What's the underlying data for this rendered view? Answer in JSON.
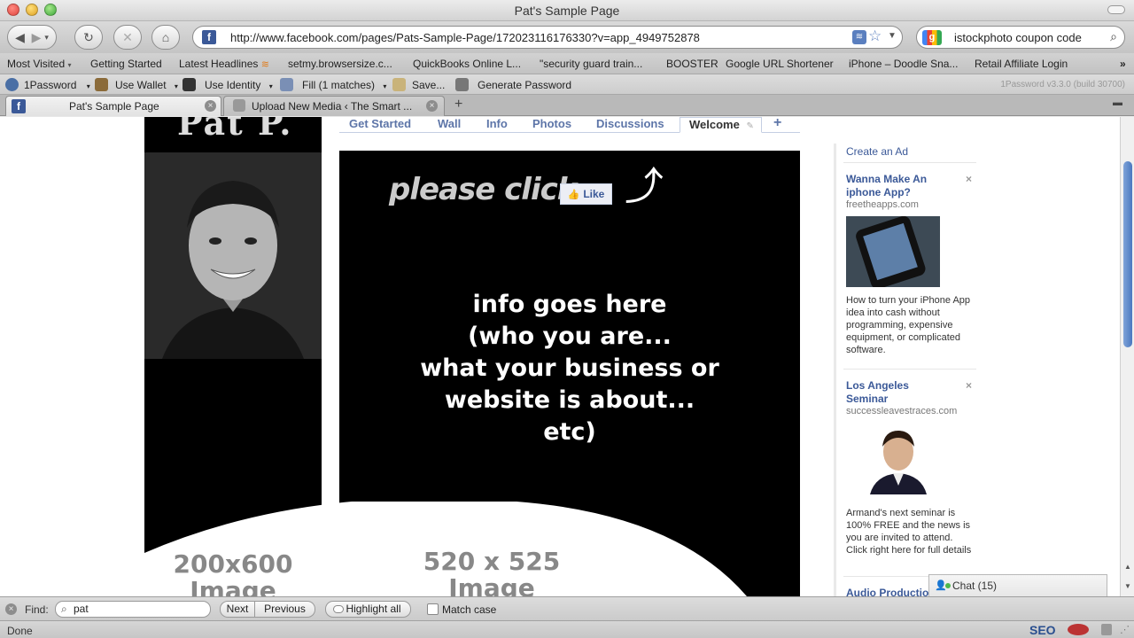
{
  "window": {
    "title": "Pat's Sample Page"
  },
  "nav": {
    "url": "http://www.facebook.com/pages/Pats-Sample-Page/172023116176330?v=app_4949752878",
    "search_query": "istockphoto coupon code"
  },
  "bookmarks": [
    "Most Visited",
    "Getting Started",
    "Latest Headlines",
    "setmy.browsersize.c...",
    "QuickBooks Online L...",
    "\"security guard train...",
    "BOOSTER",
    "Google URL Shortener",
    "iPhone – Doodle Sna...",
    "Retail Affiliate Login"
  ],
  "onepassword": {
    "items": [
      "1Password",
      "Use Wallet",
      "Use Identity",
      "Fill (1 matches)",
      "Save...",
      "Generate Password"
    ],
    "version": "1Password v3.3.0 (build 30700)"
  },
  "tabs": [
    {
      "label": "Pat's Sample Page"
    },
    {
      "label": "Upload New Media ‹ The Smart ..."
    }
  ],
  "page": {
    "name_banner": "Pat P.",
    "tabs": [
      "Get Started",
      "Wall",
      "Info",
      "Photos",
      "Discussions",
      "Welcome"
    ],
    "add_tab": "+",
    "please_click": "please click",
    "like_label": "Like",
    "info_lines": [
      "info goes here",
      "(who you are...",
      "what your business or",
      "website is about...",
      "etc)"
    ],
    "left_image_label": [
      "200x600",
      "Image"
    ],
    "main_image_label": [
      "520 x 525",
      "Image"
    ]
  },
  "ads": {
    "create_ad": "Create an Ad",
    "items": [
      {
        "title": "Wanna Make An iphone App?",
        "url": "freetheapps.com",
        "body": "How to turn your iPhone App idea into cash without programming, expensive equipment, or complicated software."
      },
      {
        "title": "Los Angeles Seminar",
        "url": "successleavestraces.com",
        "body": "Armand's next seminar is 100% FREE and the news is you are invited to attend. Click right here for full details"
      },
      {
        "title": "Audio Productio..."
      }
    ],
    "close": "×"
  },
  "chat": {
    "label": "Chat (15)"
  },
  "findbar": {
    "label": "Find:",
    "value": "pat",
    "next": "Next",
    "previous": "Previous",
    "highlight": "Highlight all",
    "match_case": "Match case"
  },
  "status": {
    "text": "Done",
    "seo": "SEO"
  }
}
